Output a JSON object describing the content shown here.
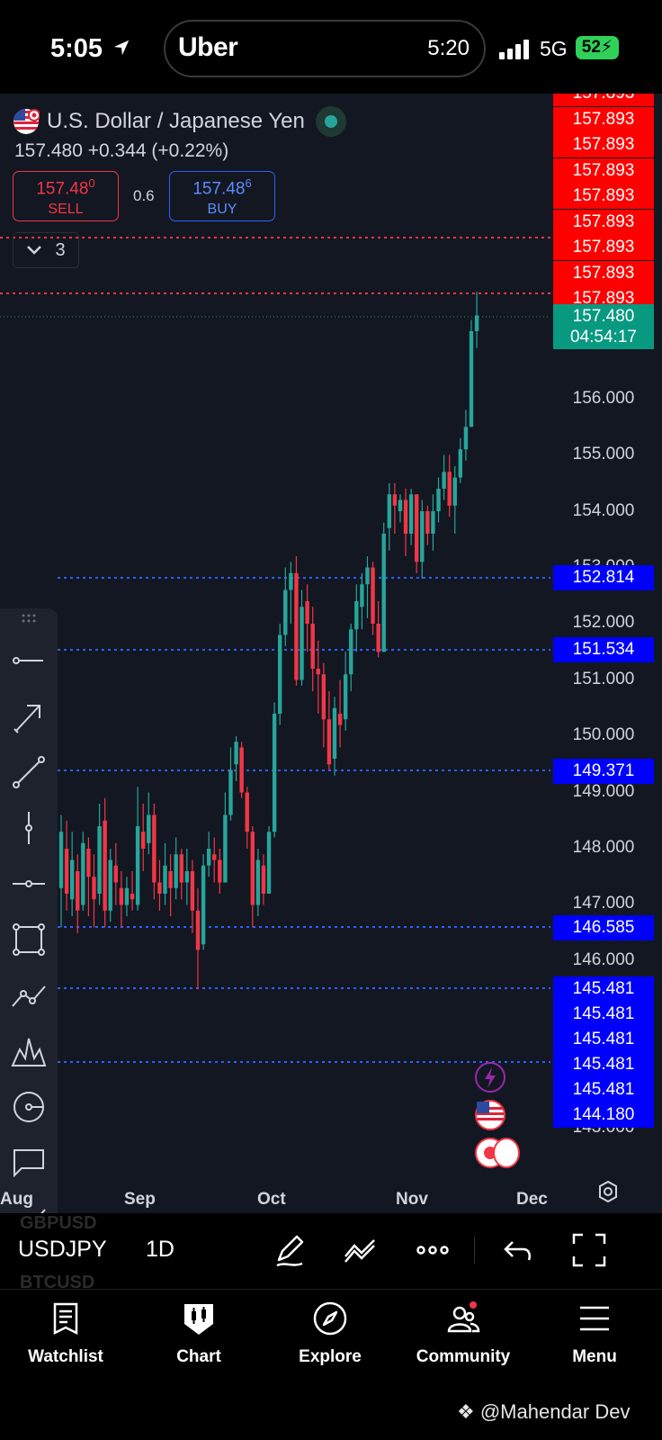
{
  "status_bar": {
    "time": "5:05",
    "island_brand": "Uber",
    "island_time": "5:20",
    "network": "5G",
    "battery": "52"
  },
  "symbol": {
    "name": "U.S. Dollar / Japanese Yen",
    "price_change": "157.480  +0.344 (+0.22%)",
    "sell_price": "157.48",
    "sell_price_sup": "0",
    "sell_label": "SELL",
    "spread": "0.6",
    "buy_price": "157.48",
    "buy_price_sup": "6",
    "buy_label": "BUY",
    "collapse_count": "3"
  },
  "colors": {
    "bg": "#131722",
    "up": "#26a69a",
    "down": "#f23645",
    "red_label": "#ff0000",
    "blue_label": "#0000ff",
    "current": "#089981"
  },
  "price_axis": {
    "ticks": [
      "156.000",
      "155.000",
      "154.000",
      "153.000",
      "152.000",
      "151.000",
      "150.000",
      "149.000",
      "148.000",
      "147.000",
      "146.000",
      "143.000"
    ],
    "current_price": "157.480",
    "countdown": "04:54:17",
    "red_level": "157.893",
    "red_level_count": 9,
    "blue_levels": [
      "152.814",
      "151.534",
      "149.371",
      "146.585",
      "145.481",
      "145.481",
      "145.481",
      "145.481",
      "145.481",
      "144.180"
    ]
  },
  "date_axis": [
    "Aug",
    "Sep",
    "Oct",
    "Nov",
    "Dec"
  ],
  "chart_data": {
    "type": "candlestick",
    "title": "",
    "ylim": [
      143,
      158
    ],
    "candles": [
      {
        "o": 147.3,
        "c": 148.3,
        "h": 148.6,
        "l": 146.6
      },
      {
        "o": 148.0,
        "c": 147.2,
        "h": 148.5,
        "l": 146.9
      },
      {
        "o": 147.1,
        "c": 147.8,
        "h": 148.3,
        "l": 146.8
      },
      {
        "o": 147.6,
        "c": 146.9,
        "h": 147.9,
        "l": 146.5
      },
      {
        "o": 147.0,
        "c": 148.1,
        "h": 148.3,
        "l": 146.9
      },
      {
        "o": 148.0,
        "c": 147.5,
        "h": 148.2,
        "l": 146.8
      },
      {
        "o": 147.5,
        "c": 147.1,
        "h": 147.9,
        "l": 146.6
      },
      {
        "o": 147.2,
        "c": 148.4,
        "h": 148.8,
        "l": 147.0
      },
      {
        "o": 148.5,
        "c": 146.9,
        "h": 148.9,
        "l": 146.6
      },
      {
        "o": 146.9,
        "c": 147.8,
        "h": 148.0,
        "l": 146.7
      },
      {
        "o": 147.7,
        "c": 147.4,
        "h": 148.1,
        "l": 147.0
      },
      {
        "o": 147.3,
        "c": 147.0,
        "h": 147.6,
        "l": 146.6
      },
      {
        "o": 147.0,
        "c": 147.3,
        "h": 147.5,
        "l": 146.8
      },
      {
        "o": 147.2,
        "c": 147.1,
        "h": 147.6,
        "l": 146.9
      },
      {
        "o": 147.0,
        "c": 148.4,
        "h": 149.1,
        "l": 146.9
      },
      {
        "o": 148.3,
        "c": 148.0,
        "h": 148.8,
        "l": 147.6
      },
      {
        "o": 148.1,
        "c": 148.6,
        "h": 149.0,
        "l": 147.9
      },
      {
        "o": 148.6,
        "c": 147.4,
        "h": 148.8,
        "l": 147.1
      },
      {
        "o": 147.4,
        "c": 147.2,
        "h": 147.8,
        "l": 146.9
      },
      {
        "o": 147.2,
        "c": 147.7,
        "h": 148.1,
        "l": 147.0
      },
      {
        "o": 147.6,
        "c": 147.3,
        "h": 147.9,
        "l": 146.8
      },
      {
        "o": 147.3,
        "c": 147.9,
        "h": 148.2,
        "l": 147.1
      },
      {
        "o": 147.9,
        "c": 147.4,
        "h": 148.0,
        "l": 147.1
      },
      {
        "o": 147.4,
        "c": 147.6,
        "h": 148.0,
        "l": 147.0
      },
      {
        "o": 147.6,
        "c": 146.9,
        "h": 147.8,
        "l": 146.5
      },
      {
        "o": 146.9,
        "c": 146.2,
        "h": 147.3,
        "l": 145.5
      },
      {
        "o": 146.3,
        "c": 147.7,
        "h": 147.9,
        "l": 146.2
      },
      {
        "o": 147.7,
        "c": 148.0,
        "h": 148.3,
        "l": 147.5
      },
      {
        "o": 147.9,
        "c": 147.8,
        "h": 148.2,
        "l": 147.4
      },
      {
        "o": 147.8,
        "c": 147.4,
        "h": 148.0,
        "l": 147.2
      },
      {
        "o": 147.4,
        "c": 148.6,
        "h": 149.0,
        "l": 147.4
      },
      {
        "o": 148.6,
        "c": 149.4,
        "h": 149.8,
        "l": 148.5
      },
      {
        "o": 149.5,
        "c": 149.9,
        "h": 150.0,
        "l": 149.2
      },
      {
        "o": 149.8,
        "c": 149.0,
        "h": 149.9,
        "l": 148.9
      },
      {
        "o": 149.0,
        "c": 148.3,
        "h": 149.1,
        "l": 148.0
      },
      {
        "o": 148.3,
        "c": 147.0,
        "h": 148.4,
        "l": 146.6
      },
      {
        "o": 147.0,
        "c": 147.8,
        "h": 148.0,
        "l": 146.8
      },
      {
        "o": 147.7,
        "c": 147.2,
        "h": 147.9,
        "l": 147.0
      },
      {
        "o": 147.2,
        "c": 148.3,
        "h": 148.4,
        "l": 149.0
      },
      {
        "o": 148.3,
        "c": 150.4,
        "h": 150.6,
        "l": 148.2
      },
      {
        "o": 150.4,
        "c": 151.8,
        "h": 152.0,
        "l": 150.2
      },
      {
        "o": 151.8,
        "c": 152.6,
        "h": 153.0,
        "l": 151.6
      },
      {
        "o": 152.6,
        "c": 152.9,
        "h": 153.1,
        "l": 152.0
      },
      {
        "o": 152.9,
        "c": 151.0,
        "h": 153.2,
        "l": 150.9
      },
      {
        "o": 151.0,
        "c": 152.3,
        "h": 152.6,
        "l": 150.9
      },
      {
        "o": 152.4,
        "c": 152.0,
        "h": 152.7,
        "l": 151.5
      },
      {
        "o": 152.0,
        "c": 151.2,
        "h": 152.3,
        "l": 150.8
      },
      {
        "o": 151.2,
        "c": 151.1,
        "h": 151.7,
        "l": 150.4
      },
      {
        "o": 151.1,
        "c": 150.3,
        "h": 151.3,
        "l": 149.8
      },
      {
        "o": 150.3,
        "c": 149.5,
        "h": 150.8,
        "l": 149.4
      },
      {
        "o": 149.6,
        "c": 150.5,
        "h": 150.7,
        "l": 149.3
      },
      {
        "o": 150.4,
        "c": 150.2,
        "h": 151.0,
        "l": 149.8
      },
      {
        "o": 150.3,
        "c": 151.1,
        "h": 151.5,
        "l": 150.1
      },
      {
        "o": 151.1,
        "c": 151.9,
        "h": 152.0,
        "l": 150.8
      },
      {
        "o": 151.9,
        "c": 152.4,
        "h": 152.7,
        "l": 151.5
      },
      {
        "o": 152.3,
        "c": 152.7,
        "h": 152.9,
        "l": 151.9
      },
      {
        "o": 152.7,
        "c": 153.0,
        "h": 153.2,
        "l": 152.1
      },
      {
        "o": 153.0,
        "c": 152.0,
        "h": 153.1,
        "l": 151.8
      },
      {
        "o": 152.0,
        "c": 151.5,
        "h": 152.4,
        "l": 151.4
      },
      {
        "o": 151.5,
        "c": 153.6,
        "h": 153.8,
        "l": 151.5
      },
      {
        "o": 153.7,
        "c": 154.3,
        "h": 154.5,
        "l": 153.3
      },
      {
        "o": 154.3,
        "c": 154.1,
        "h": 154.5,
        "l": 153.6
      },
      {
        "o": 154.0,
        "c": 154.2,
        "h": 154.3,
        "l": 153.8
      },
      {
        "o": 154.2,
        "c": 153.6,
        "h": 154.4,
        "l": 153.2
      },
      {
        "o": 153.6,
        "c": 154.3,
        "h": 154.4,
        "l": 153.4
      },
      {
        "o": 154.3,
        "c": 153.1,
        "h": 154.3,
        "l": 152.9
      },
      {
        "o": 153.1,
        "c": 154.0,
        "h": 154.2,
        "l": 152.8
      },
      {
        "o": 154.0,
        "c": 153.6,
        "h": 154.1,
        "l": 153.4
      },
      {
        "o": 153.6,
        "c": 154.0,
        "h": 154.3,
        "l": 153.3
      },
      {
        "o": 154.0,
        "c": 154.4,
        "h": 154.6,
        "l": 153.8
      },
      {
        "o": 154.4,
        "c": 154.7,
        "h": 155.0,
        "l": 154.2
      },
      {
        "o": 154.7,
        "c": 154.1,
        "h": 155.0,
        "l": 153.9
      },
      {
        "o": 154.1,
        "c": 154.6,
        "h": 154.8,
        "l": 153.6
      },
      {
        "o": 154.6,
        "c": 155.1,
        "h": 155.3,
        "l": 154.5
      },
      {
        "o": 155.1,
        "c": 155.5,
        "h": 155.8,
        "l": 154.9
      },
      {
        "o": 155.5,
        "c": 157.2,
        "h": 157.4,
        "l": 155.5
      },
      {
        "o": 157.2,
        "c": 157.48,
        "h": 157.9,
        "l": 156.9
      }
    ]
  },
  "bottom_bar": {
    "ghost_top": "GBPUSD",
    "symbol": "USDJPY",
    "timeframe": "1D",
    "ghost_bottom": "BTCUSD"
  },
  "tabs": [
    "Watchlist",
    "Chart",
    "Explore",
    "Community",
    "Menu"
  ],
  "watermark": "@Mahendar Dev"
}
